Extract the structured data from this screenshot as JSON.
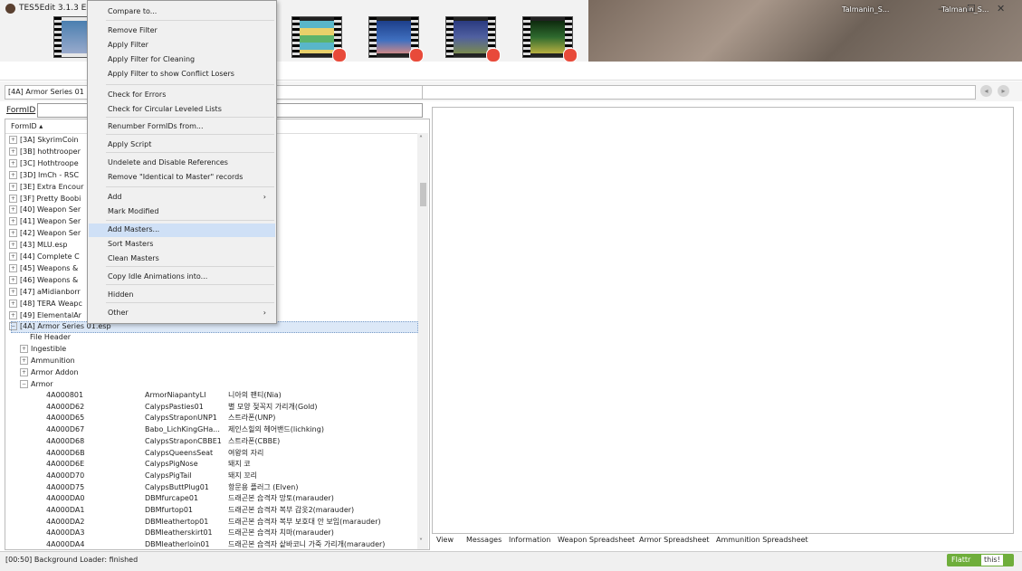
{
  "desktop": {
    "icon1": "Talmanin_S...",
    "icon2": "Talmanin_S..."
  },
  "window": {
    "title": "TES5Edit 3.1.3 EX",
    "minimize": "–",
    "maximize": "☐",
    "close": "✕"
  },
  "path": {
    "value": "[4A] Armor Series 01",
    "back": "◂",
    "forward": "▸"
  },
  "formid": {
    "label": "FormID"
  },
  "tree": {
    "header": "FormID ▴",
    "plugins": [
      "[3A] SkyrimCoin",
      "[3B] hothtrooper",
      "[3C] Hothtroope",
      "[3D] ImCh - RSC",
      "[3E] Extra Encour",
      "[3F] Pretty Boobi",
      "[40] Weapon Ser",
      "[41] Weapon Ser",
      "[42] Weapon Ser",
      "[43] MLU.esp",
      "[44] Complete C",
      "[45] Weapons &",
      "[46] Weapons &",
      "[47] aMidianborr",
      "[48] TERA Weapc",
      "[49] ElementalAr"
    ],
    "selected": "[4A] Armor Series 01.esp",
    "groups": [
      "File Header",
      "Ingestible",
      "Ammunition",
      "Armor Addon",
      "Armor"
    ],
    "records": [
      {
        "id": "4A000801",
        "edid": "ArmorNiapantyLI",
        "name": "니아의 팬티(Nia)"
      },
      {
        "id": "4A000D62",
        "edid": "CalypsPasties01",
        "name": "별 모양 젖꼭지 가리개(Gold)"
      },
      {
        "id": "4A000D65",
        "edid": "CalypsStraponUNP1",
        "name": "스트라폰(UNP)"
      },
      {
        "id": "4A000D67",
        "edid": "Babo_LichKingGHa...",
        "name": "제인스힐의 헤어밴드(lichking)"
      },
      {
        "id": "4A000D68",
        "edid": "CalypsStraponCBBE1",
        "name": "스트라폰(CBBE)"
      },
      {
        "id": "4A000D6B",
        "edid": "CalypsQueensSeat",
        "name": "여왕의 자리"
      },
      {
        "id": "4A000D6E",
        "edid": "CalypsPigNose",
        "name": "돼지 코"
      },
      {
        "id": "4A000D70",
        "edid": "CalypsPigTail",
        "name": "돼지 꼬리"
      },
      {
        "id": "4A000D75",
        "edid": "CalypsButtPlug01",
        "name": "항문용 플러그 (Elven)"
      },
      {
        "id": "4A000DA0",
        "edid": "DBMfurcape01",
        "name": "드래곤본 습격자 망토(marauder)"
      },
      {
        "id": "4A000DA1",
        "edid": "DBMfurtop01",
        "name": "드래곤본 습격자 복부 갑옷2(marauder)"
      },
      {
        "id": "4A000DA2",
        "edid": "DBMleathertop01",
        "name": "드래곤본 습격자 복부 보호대 안 보임(marauder)"
      },
      {
        "id": "4A000DA3",
        "edid": "DBMleatherskirt01",
        "name": "드래곤본 습격자 치마(marauder)"
      },
      {
        "id": "4A000DA4",
        "edid": "DBMleatherloin01",
        "name": "드래곤본 습격자 샅바코니 가죽 가리개(marauder)"
      }
    ]
  },
  "tabs": [
    "View",
    "Messages",
    "Information",
    "Weapon Spreadsheet",
    "Armor Spreadsheet",
    "Ammunition Spreadsheet"
  ],
  "status": {
    "text": "[00:50] Background Loader: finished",
    "flattr": "Flattr",
    "flattr_this": "this!"
  },
  "menu": {
    "items": [
      "Compare to...",
      "Remove Filter",
      "Apply Filter",
      "Apply Filter for Cleaning",
      "Apply Filter to show Conflict Losers",
      "Check for Errors",
      "Check for Circular Leveled Lists",
      "Renumber FormIDs from...",
      "Apply Script",
      "Undelete and Disable References",
      "Remove \"Identical to Master\" records",
      "Add",
      "Mark Modified",
      "Add Masters...",
      "Sort Masters",
      "Clean Masters",
      "Copy Idle Animations into...",
      "Hidden",
      "Other"
    ],
    "submenu_arrow": "›"
  }
}
